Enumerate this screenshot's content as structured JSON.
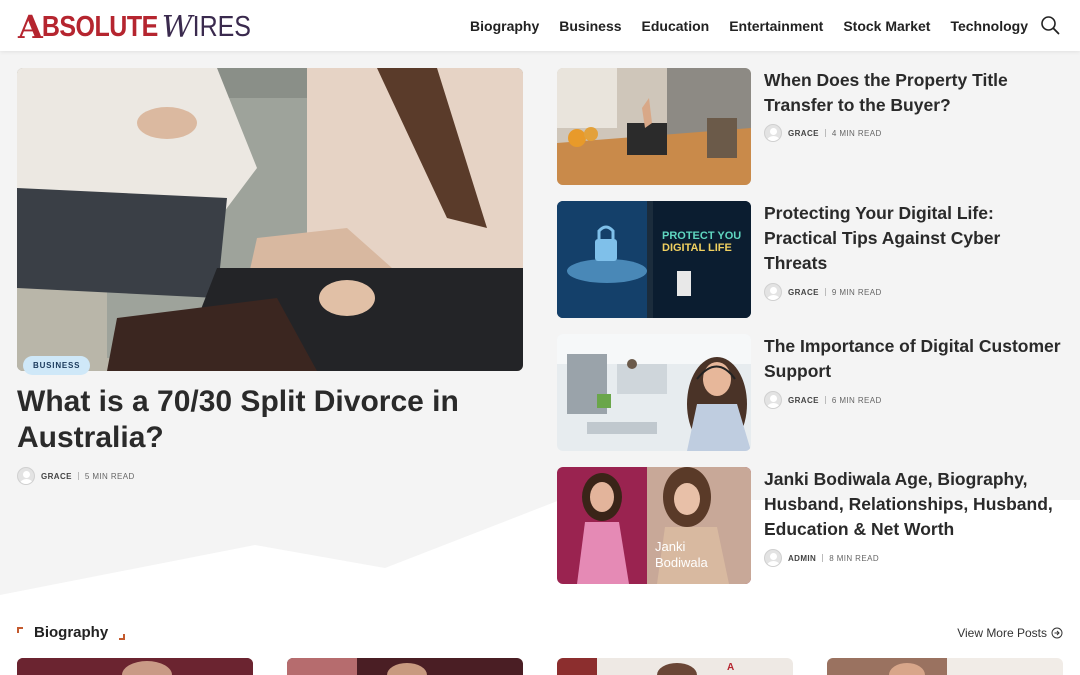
{
  "brand": {
    "logo_a": "A",
    "logo_bsolute": "BSOLUTE",
    "logo_w": "W",
    "logo_ires": "IRES"
  },
  "nav": [
    {
      "label": "Biography"
    },
    {
      "label": "Business"
    },
    {
      "label": "Education"
    },
    {
      "label": "Entertainment"
    },
    {
      "label": "Stock Market"
    },
    {
      "label": "Technology"
    }
  ],
  "hero": {
    "category": "BUSINESS",
    "title": "What is a 70/30 Split Divorce in Australia?",
    "author": "GRACE",
    "read_time": "5 MIN READ"
  },
  "side_posts": [
    {
      "title": "When Does the Property Title Transfer to the Buyer?",
      "author": "GRACE",
      "read_time": "4 MIN READ"
    },
    {
      "title": "Protecting Your Digital Life: Practical Tips Against Cyber Threats",
      "author": "GRACE",
      "read_time": "9 MIN READ",
      "thumb_text_1": "PROTECT YOU",
      "thumb_text_2": "DIGITAL LIFE"
    },
    {
      "title": "The Importance of Digital Customer Support",
      "author": "GRACE",
      "read_time": "6 MIN READ"
    },
    {
      "title": "Janki Bodiwala Age, Biography, Husband, Relationships, Husband, Education & Net Worth",
      "author": "ADMIN",
      "read_time": "8 MIN READ",
      "thumb_text_1": "Janki",
      "thumb_text_2": "Bodiwala"
    }
  ],
  "section": {
    "title": "Biography",
    "view_more": "View More Posts"
  },
  "colors": {
    "brand_red": "#b5252f",
    "brand_purple": "#3a2a4e",
    "badge_bg": "#cfe8f8",
    "accent_bracket": "#c45a2e"
  },
  "icons": [
    "search-icon",
    "arrow-circle-right-icon",
    "avatar-icon"
  ]
}
